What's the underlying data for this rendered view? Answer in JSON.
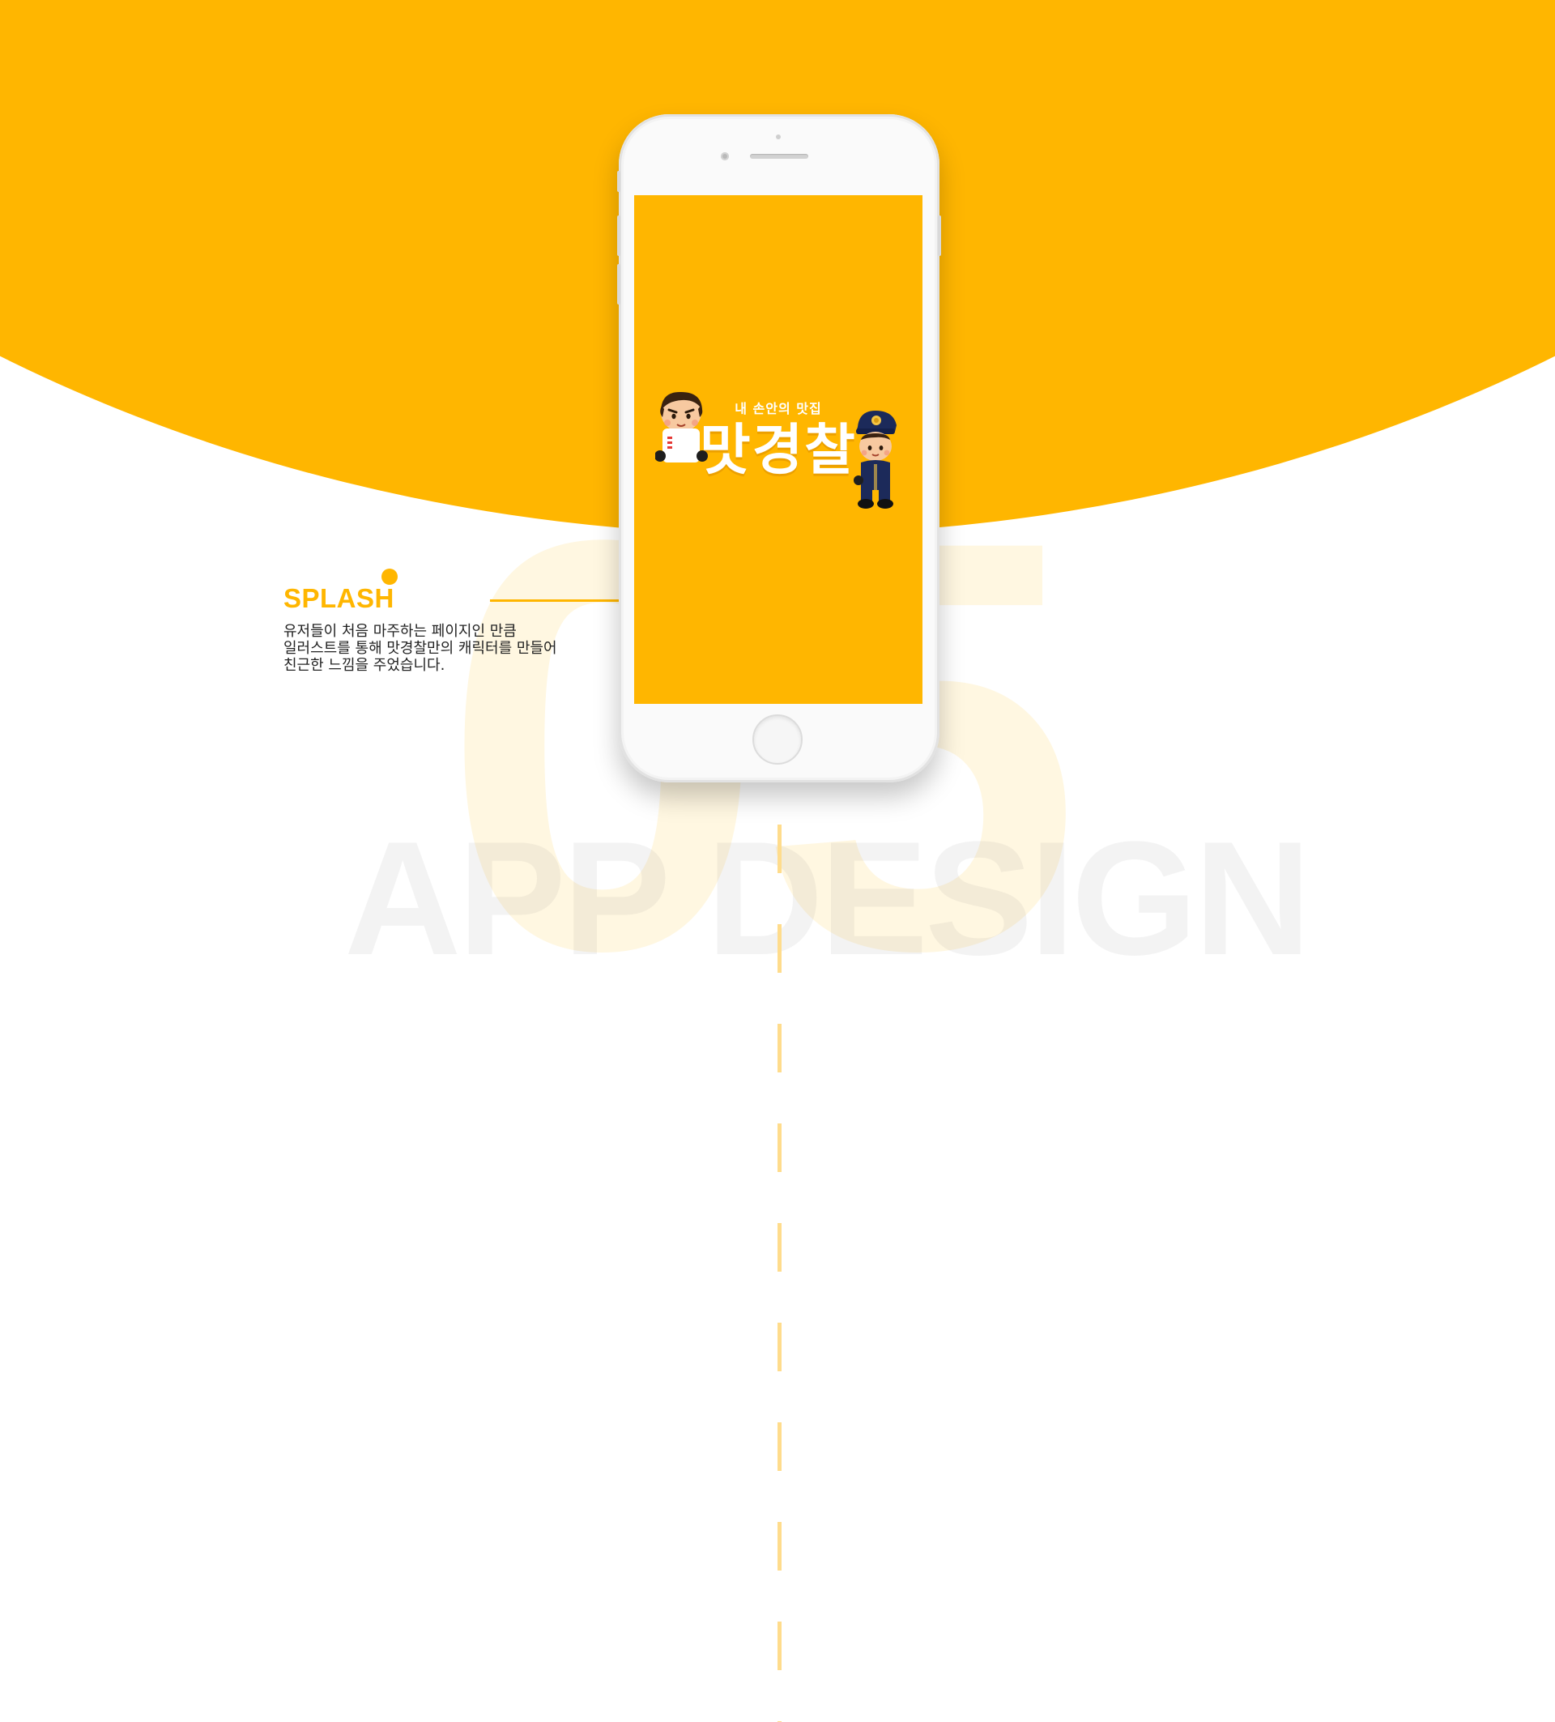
{
  "colors": {
    "accent": "#ffb600",
    "dash": "#ffdc8c",
    "text": "#222222"
  },
  "section": {
    "number": "05",
    "watermark": "APP DESIGN",
    "title": "SPLASH",
    "description": [
      "유저들이 처음 마주하는 페이지인 만큼",
      "일러스트를 통해 맛경찰만의 캐릭터를 만들어",
      "친근한 느낌을 주었습니다."
    ]
  },
  "app": {
    "tagline": "내 손안의 맛집",
    "logo": "맛경찰",
    "characters": [
      "boy-character-icon",
      "police-character-icon"
    ]
  }
}
